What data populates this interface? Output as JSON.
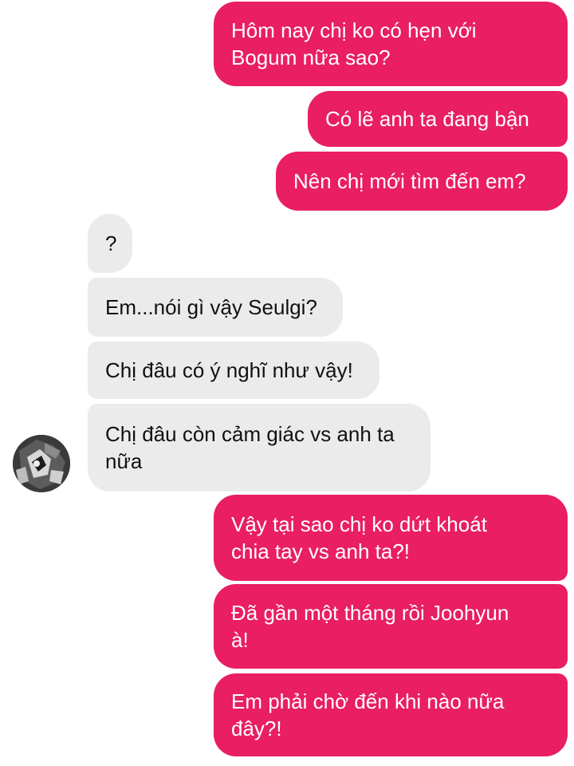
{
  "colors": {
    "outgoing_bubble": "#e91e63",
    "outgoing_text": "#ffffff",
    "incoming_bubble": "#ebebeb",
    "incoming_text": "#111111"
  },
  "contact": {
    "avatar_icon": "contact-avatar-photo"
  },
  "messages": [
    {
      "direction": "outgoing",
      "text": "Hôm nay chị ko có hẹn với\nBogum nữa sao?"
    },
    {
      "direction": "outgoing",
      "text": "Có lẽ anh ta đang bận"
    },
    {
      "direction": "outgoing",
      "text": "Nên chị mới tìm đến em?"
    },
    {
      "direction": "incoming",
      "text": "?"
    },
    {
      "direction": "incoming",
      "text": "Em...nói gì vậy Seulgi?"
    },
    {
      "direction": "incoming",
      "text": "Chị đâu có ý nghĩ như vậy!"
    },
    {
      "direction": "incoming",
      "text": "Chị đâu còn cảm giác vs anh ta\nnữa"
    },
    {
      "direction": "outgoing",
      "text": "Vậy tại sao chị ko dứt khoát\nchia tay vs anh ta?!"
    },
    {
      "direction": "outgoing",
      "text": "Đã gần một tháng rồi Joohyun\nà!"
    },
    {
      "direction": "outgoing",
      "text": "Em phải chờ đến khi nào nữa\nđây?!"
    }
  ]
}
